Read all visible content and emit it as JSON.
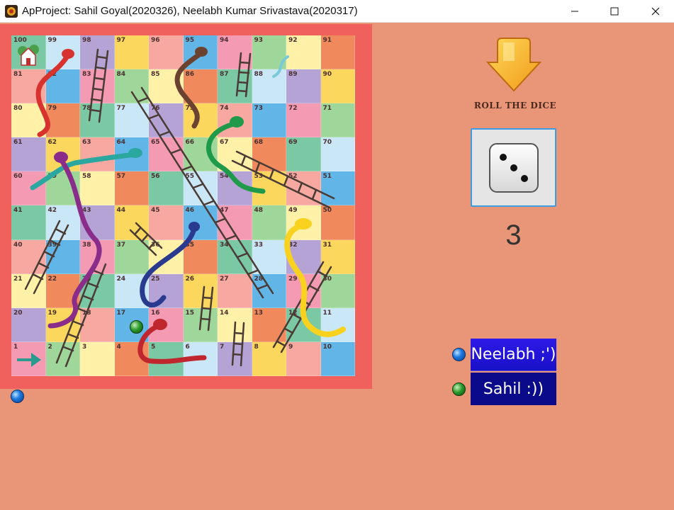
{
  "window": {
    "title": "ApProject: Sahil Goyal(2020326), Neelabh Kumar Srivastava(2020317)",
    "controls": [
      "minimize-icon",
      "maximize-icon",
      "close-icon"
    ]
  },
  "board": {
    "rows": [
      [
        100,
        99,
        98,
        97,
        96,
        95,
        94,
        93,
        92,
        91
      ],
      [
        81,
        82,
        83,
        84,
        85,
        86,
        87,
        88,
        89,
        90
      ],
      [
        80,
        79,
        78,
        77,
        76,
        75,
        74,
        73,
        72,
        71
      ],
      [
        61,
        62,
        63,
        64,
        65,
        66,
        67,
        68,
        69,
        70
      ],
      [
        60,
        59,
        58,
        57,
        56,
        55,
        54,
        53,
        52,
        51
      ],
      [
        41,
        42,
        43,
        44,
        45,
        46,
        47,
        48,
        49,
        50
      ],
      [
        40,
        39,
        38,
        37,
        36,
        35,
        34,
        33,
        32,
        31
      ],
      [
        21,
        22,
        23,
        24,
        25,
        26,
        27,
        28,
        29,
        30
      ],
      [
        20,
        19,
        18,
        17,
        16,
        15,
        14,
        13,
        12,
        11
      ],
      [
        1,
        2,
        3,
        4,
        5,
        6,
        7,
        8,
        9,
        10
      ]
    ],
    "palette": [
      "#7bc8a4",
      "#fbd85d",
      "#f49ab3",
      "#f08a5d",
      "#b5a3d6",
      "#62b6e7",
      "#fff1a8",
      "#c9e7f7",
      "#f7a8a0",
      "#9fd69a"
    ],
    "frame_color": "#f0605c"
  },
  "tokens": {
    "player_1_color": "blue",
    "player_2_color": "green"
  },
  "controls": {
    "roll_label": "ROLL THE DICE",
    "dice_value": "3",
    "arrow_icon": "down-arrow-icon",
    "dice_icon": "dice-icon"
  },
  "players": [
    {
      "label": "Neelabh ;')",
      "token": "blue"
    },
    {
      "label": "Sahil :))",
      "token": "green"
    }
  ],
  "colors": {
    "background": "#e89677",
    "active_player": "#2318dc",
    "inactive_player": "#0a0a8a",
    "dice_border": "#3d9de0"
  }
}
